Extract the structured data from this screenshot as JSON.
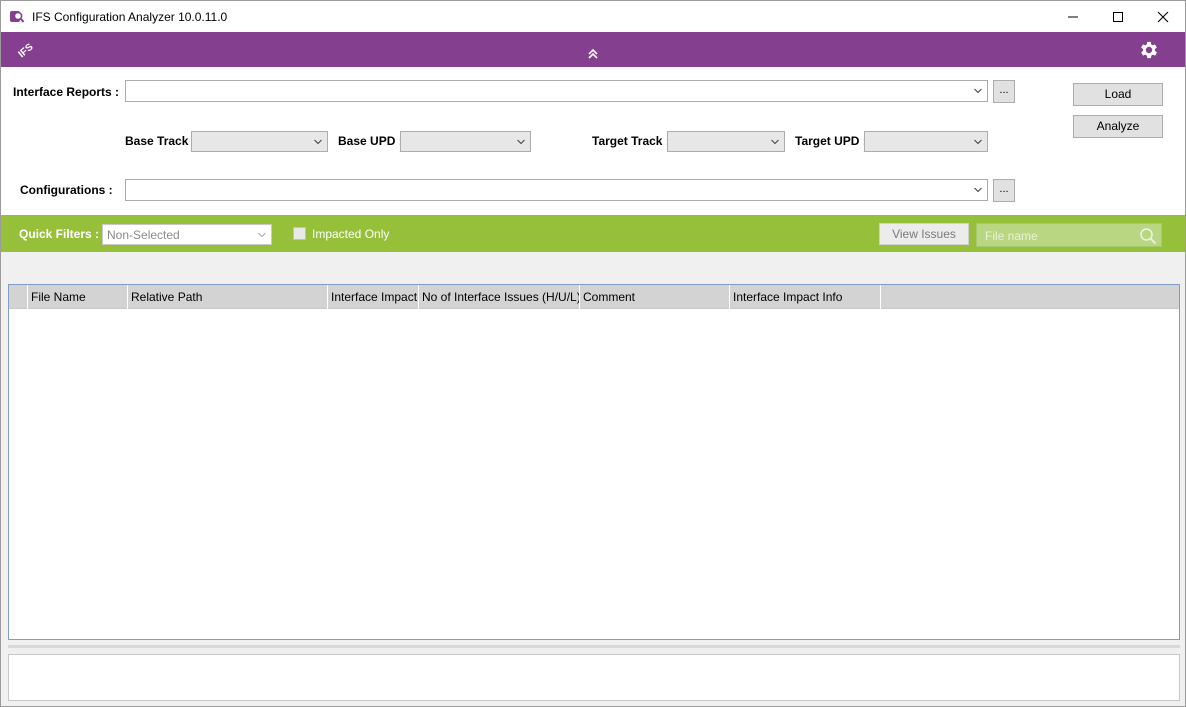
{
  "window": {
    "title": "IFS Configuration Analyzer 10.0.11.0"
  },
  "ribbon": {
    "background_color": "#84408f",
    "logo": "IFS",
    "collapse_icon": "double-chevron-up-icon",
    "settings_icon": "gear-icon"
  },
  "form": {
    "interface_reports_label": "Interface Reports :",
    "interface_reports_value": "",
    "browse_label": "...",
    "base_track_label": "Base Track :",
    "base_upd_label": "Base UPD :",
    "target_track_label": "Target Track :",
    "target_upd_label": "Target UPD :",
    "configurations_label": "Configurations :",
    "configurations_value": "",
    "load_label": "Load",
    "analyze_label": "Analyze"
  },
  "filters": {
    "background_color": "#96c03a",
    "quick_filters_label": "Quick Filters :",
    "quick_filters_value": "Non-Selected",
    "impacted_only_label": "Impacted Only",
    "impacted_only_checked": false,
    "view_issues_label": "View Issues",
    "search_placeholder": "File name"
  },
  "grid": {
    "columns": [
      "File Name",
      "Relative Path",
      "Interface Impact",
      "No of Interface Issues (H/U/L)",
      "Comment",
      "Interface Impact Info"
    ],
    "rows": []
  }
}
